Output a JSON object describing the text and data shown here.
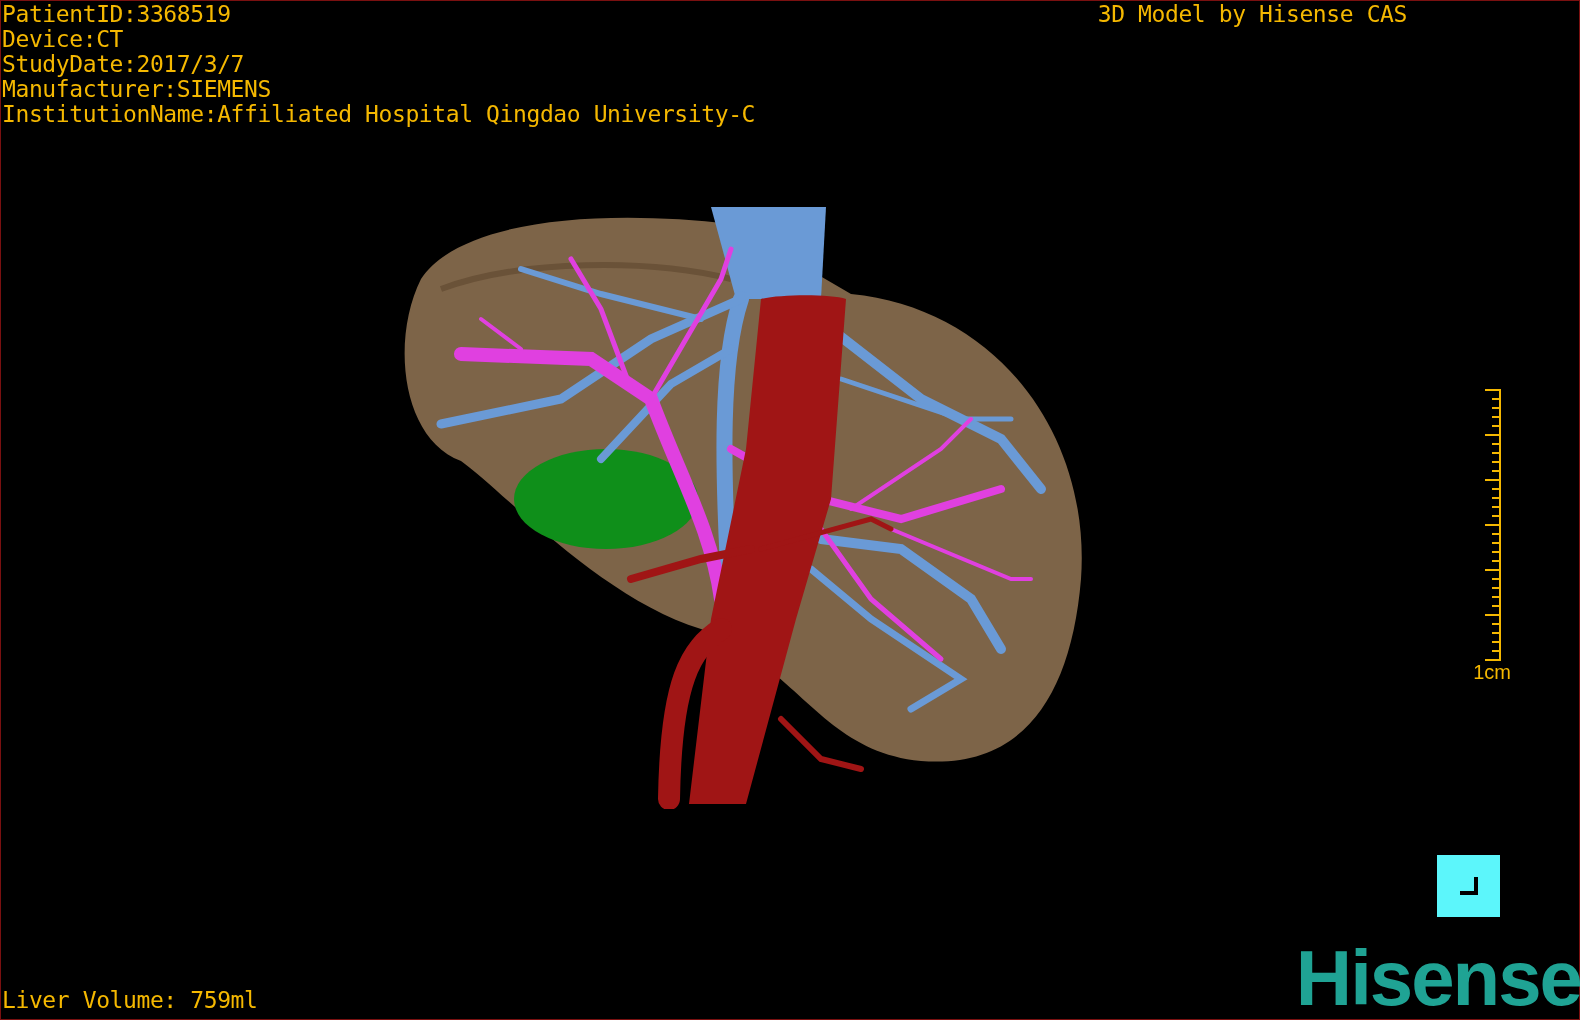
{
  "study_info": [
    "PatientID:3368519",
    "Device:CT",
    "StudyDate:2017/3/7",
    "Manufacturer:SIEMENS",
    "InstitutionName:Affiliated Hospital Qingdao University-C"
  ],
  "viewer_title": "3D Model by Hisense CAS",
  "scale_bar": {
    "label": "1cm"
  },
  "liver_volume": "Liver Volume: 759ml",
  "logo": "Hisense"
}
